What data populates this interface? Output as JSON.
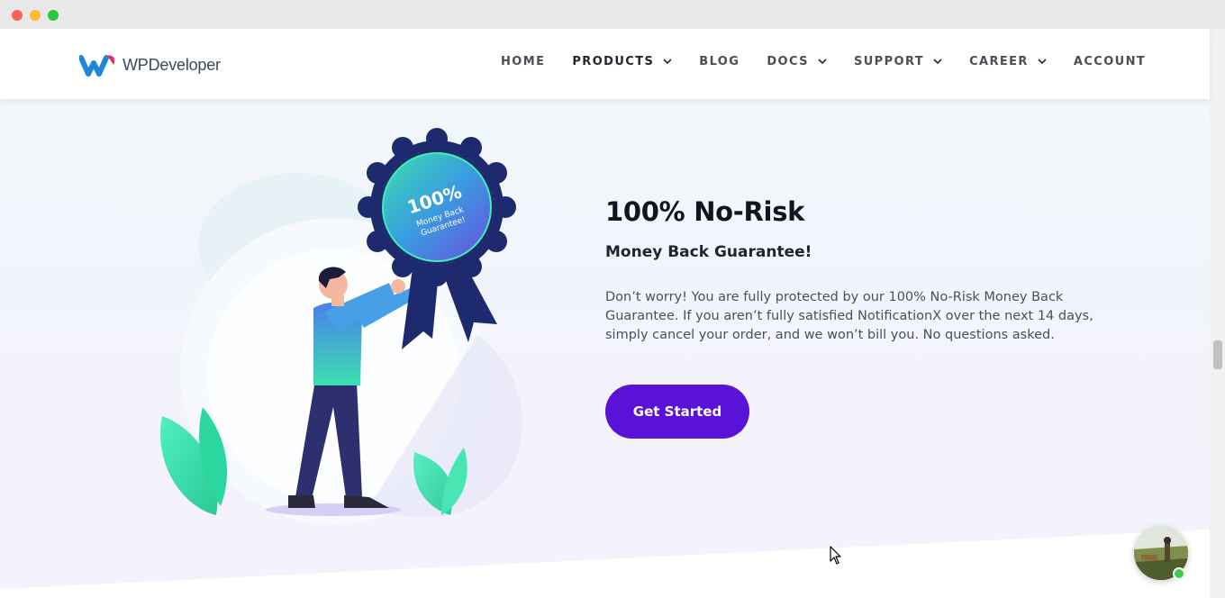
{
  "window": {
    "controls": [
      "close",
      "minimize",
      "maximize"
    ]
  },
  "brand": {
    "name": "WPDeveloper",
    "accent": "#5a12d8"
  },
  "nav": {
    "items": [
      {
        "label": "HOME",
        "has_dropdown": false
      },
      {
        "label": "PRODUCTS",
        "has_dropdown": true,
        "active": true
      },
      {
        "label": "BLOG",
        "has_dropdown": false
      },
      {
        "label": "DOCS",
        "has_dropdown": true
      },
      {
        "label": "SUPPORT",
        "has_dropdown": true
      },
      {
        "label": "CAREER",
        "has_dropdown": true
      },
      {
        "label": "ACCOUNT",
        "has_dropdown": false
      }
    ]
  },
  "badge": {
    "percent": "100%",
    "line1": "Money Back",
    "line2": "Guarantee!"
  },
  "hero": {
    "headline": "100% No-Risk",
    "subhead": "Money Back Guarantee!",
    "body": "Don’t worry! You are fully protected by our 100% No-Risk Money Back Guarantee. If you aren’t fully satisfied NotificationX over the next 14 days, simply cancel your order, and we won’t bill you. No questions asked.",
    "cta_label": "Get Started"
  },
  "chat": {
    "status": "online",
    "status_color": "#3ccf4e"
  }
}
